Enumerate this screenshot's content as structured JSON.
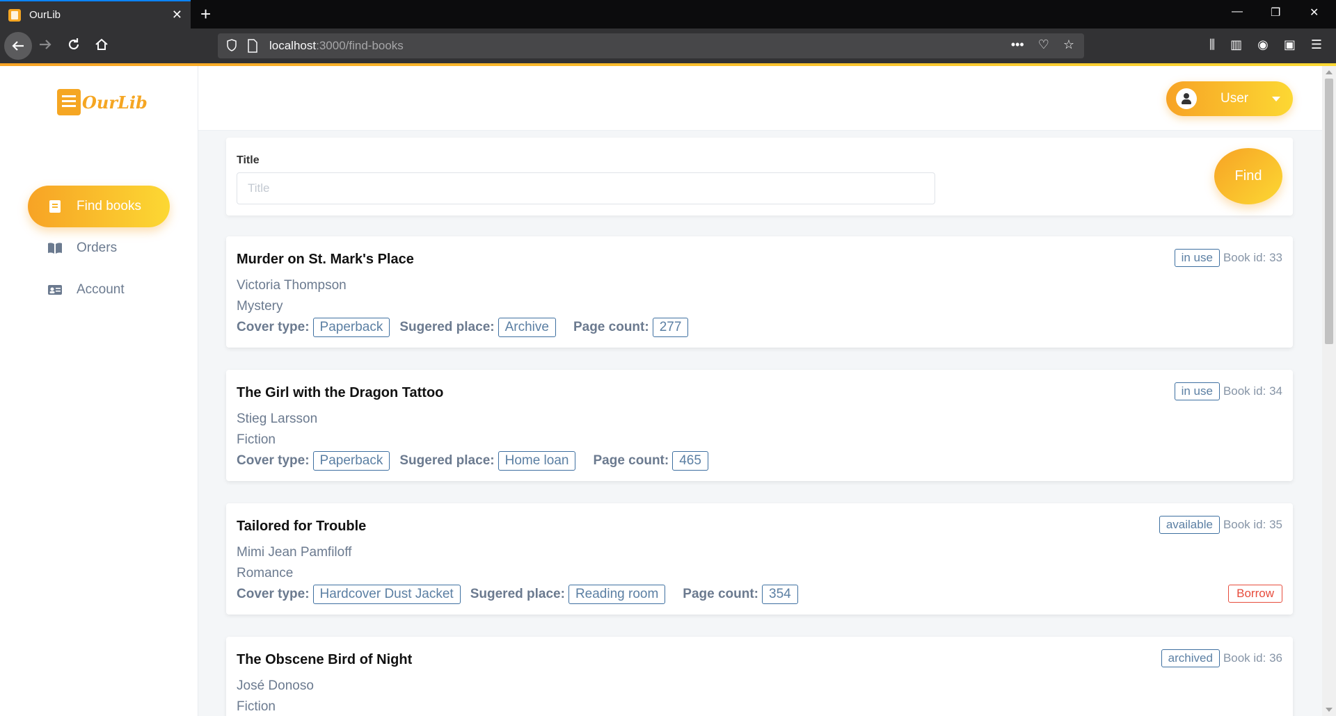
{
  "browser": {
    "tab_title": "OurLib",
    "url_host": "localhost",
    "url_path": ":3000/find-books"
  },
  "app": {
    "logo_text": "OurLib",
    "sidebar": {
      "items": [
        {
          "label": "Find books",
          "icon": "book-icon",
          "active": true
        },
        {
          "label": "Orders",
          "icon": "open-book-icon",
          "active": false
        },
        {
          "label": "Account",
          "icon": "id-card-icon",
          "active": false
        }
      ]
    },
    "user_menu": {
      "label": "User"
    },
    "search": {
      "label": "Title",
      "placeholder": "Title",
      "value": "",
      "button": "Find"
    },
    "labels": {
      "cover_type": "Cover type:",
      "sugered_place": "Sugered place:",
      "page_count": "Page count:",
      "borrow": "Borrow"
    },
    "books": [
      {
        "title": "Murder on St. Mark's Place",
        "author": "Victoria Thompson",
        "genre": "Mystery",
        "cover_type": "Paperback",
        "place": "Archive",
        "page_count": "277",
        "status": "in use",
        "book_id": "Book id: 33"
      },
      {
        "title": "The Girl with the Dragon Tattoo",
        "author": "Stieg Larsson",
        "genre": "Fiction",
        "cover_type": "Paperback",
        "place": "Home loan",
        "page_count": "465",
        "status": "in use",
        "book_id": "Book id: 34"
      },
      {
        "title": "Tailored for Trouble",
        "author": "Mimi Jean Pamfiloff",
        "genre": "Romance",
        "cover_type": "Hardcover Dust Jacket",
        "place": "Reading room",
        "page_count": "354",
        "status": "available",
        "book_id": "Book id: 35"
      },
      {
        "title": "The Obscene Bird of Night",
        "author": "José Donoso",
        "genre": "Fiction",
        "status": "archived",
        "book_id": "Book id: 36"
      }
    ],
    "colors": {
      "accent_start": "#f7a325",
      "accent_end": "#fcd833",
      "tag_border": "#3d6fa0",
      "borrow": "#e74c3c"
    }
  }
}
